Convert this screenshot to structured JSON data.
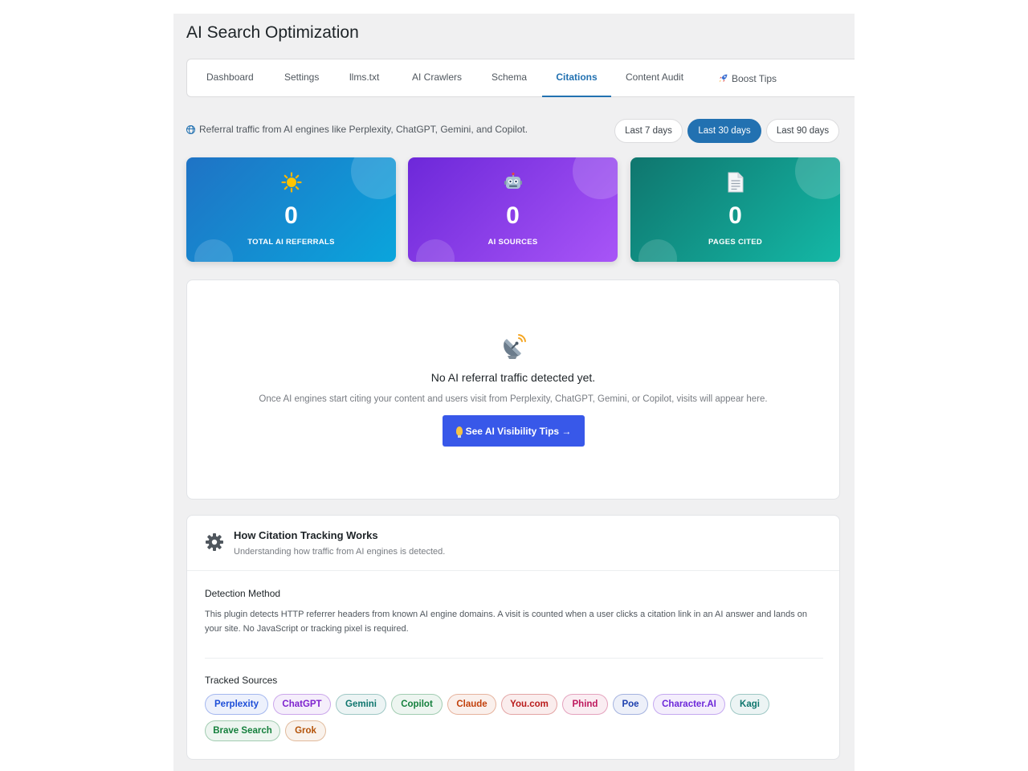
{
  "page": {
    "title": "AI Search Optimization"
  },
  "tabs": [
    {
      "label": "Dashboard"
    },
    {
      "label": "Settings"
    },
    {
      "label": "llms.txt"
    },
    {
      "label": "AI Crawlers"
    },
    {
      "label": "Schema"
    },
    {
      "label": "Citations"
    },
    {
      "label": "Content Audit"
    },
    {
      "label": "Boost Tips"
    }
  ],
  "active_tab": "Citations",
  "info": {
    "text": "Referral traffic from AI engines like Perplexity, ChatGPT, Gemini, and Copilot."
  },
  "range": {
    "options": [
      {
        "label": "Last 7 days"
      },
      {
        "label": "Last 30 days"
      },
      {
        "label": "Last 90 days"
      }
    ],
    "selected": "Last 30 days"
  },
  "stats": [
    {
      "icon": "sun-icon",
      "value": "0",
      "label": "TOTAL AI REFERRALS",
      "color": "#1f73c5"
    },
    {
      "icon": "robot-icon",
      "value": "0",
      "label": "AI SOURCES",
      "color": "#7c3aed"
    },
    {
      "icon": "document-icon",
      "value": "0",
      "label": "PAGES CITED",
      "color": "#0f766e"
    }
  ],
  "empty_state": {
    "icon": "satellite-dish-icon",
    "title": "No AI referral traffic detected yet.",
    "description": "Once AI engines start citing your content and users visit from Perplexity, ChatGPT, Gemini, or Copilot, visits will appear here.",
    "button_label": "See AI Visibility Tips →"
  },
  "how_it_works": {
    "title": "How Citation Tracking Works",
    "subtitle": "Understanding how traffic from AI engines is detected.",
    "detection_title": "Detection Method",
    "detection_text": "This plugin detects HTTP referrer headers from known AI engine domains. A visit is counted when a user clicks a citation link in an AI answer and lands on your site. No JavaScript or tracking pixel is required.",
    "sources_title": "Tracked Sources",
    "sources": [
      {
        "name": "Perplexity",
        "color": "#1d4ed8"
      },
      {
        "name": "ChatGPT",
        "color": "#7e22ce"
      },
      {
        "name": "Gemini",
        "color": "#0f766e"
      },
      {
        "name": "Copilot",
        "color": "#15803d"
      },
      {
        "name": "Claude",
        "color": "#c2410c"
      },
      {
        "name": "You.com",
        "color": "#b91c1c"
      },
      {
        "name": "Phind",
        "color": "#be185d"
      },
      {
        "name": "Poe",
        "color": "#1e40af"
      },
      {
        "name": "Character.AI",
        "color": "#6d28d9"
      },
      {
        "name": "Kagi",
        "color": "#0f766e"
      },
      {
        "name": "Brave Search",
        "color": "#15803d"
      },
      {
        "name": "Grok",
        "color": "#b45309"
      }
    ]
  }
}
